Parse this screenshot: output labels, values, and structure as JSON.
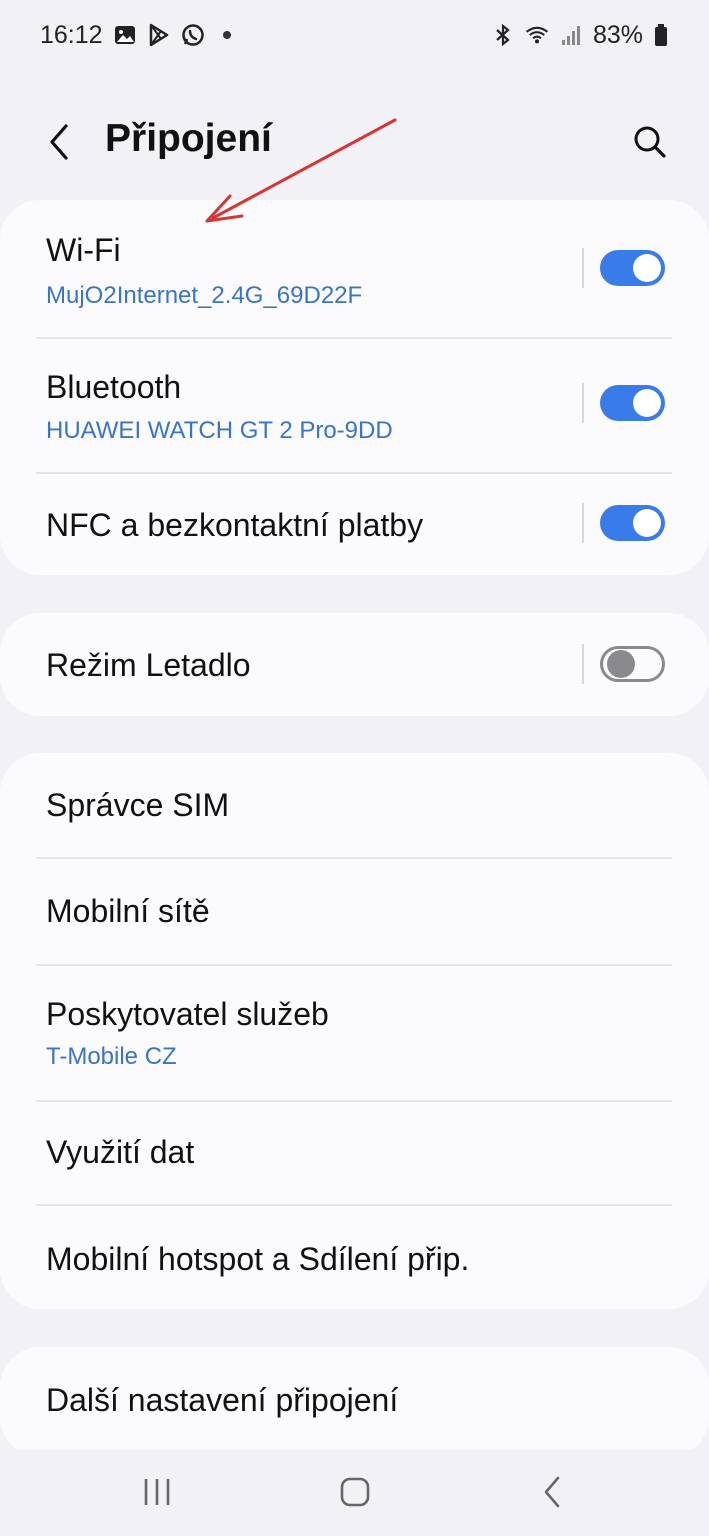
{
  "status_bar": {
    "time": "16:12",
    "battery": "83%",
    "left_icons": [
      "gallery-icon",
      "play-store-icon",
      "whatsapp-icon",
      "notification-dot"
    ],
    "right_icons": [
      "bluetooth-icon",
      "wifi-icon",
      "signal-icon",
      "battery-icon"
    ]
  },
  "header": {
    "title": "Připojení",
    "back_icon": "back-icon",
    "search_icon": "search-icon"
  },
  "colors": {
    "accent": "#3a7bea",
    "subtitle": "#3a74c4",
    "annotation_arrow": "#d93333"
  },
  "groups": [
    {
      "items": [
        {
          "title": "Wi-Fi",
          "subtitle": "MujO2Internet_2.4G_69D22F",
          "toggle": "on"
        },
        {
          "title": "Bluetooth",
          "subtitle": "HUAWEI WATCH GT 2 Pro-9DD",
          "toggle": "on"
        },
        {
          "title": "NFC a bezkontaktní platby",
          "toggle": "on"
        }
      ]
    },
    {
      "items": [
        {
          "title": "Režim Letadlo",
          "toggle": "off"
        }
      ]
    },
    {
      "items": [
        {
          "title": "Správce SIM"
        },
        {
          "title": "Mobilní sítě"
        },
        {
          "title": "Poskytovatel služeb",
          "subtitle": "T-Mobile CZ"
        },
        {
          "title": "Využití dat"
        },
        {
          "title": "Mobilní hotspot a Sdílení přip."
        }
      ]
    },
    {
      "items": [
        {
          "title": "Další nastavení připojení"
        }
      ]
    }
  ],
  "nav_bar": {
    "icons": [
      "recent-apps-icon",
      "home-icon",
      "back-nav-icon"
    ]
  }
}
